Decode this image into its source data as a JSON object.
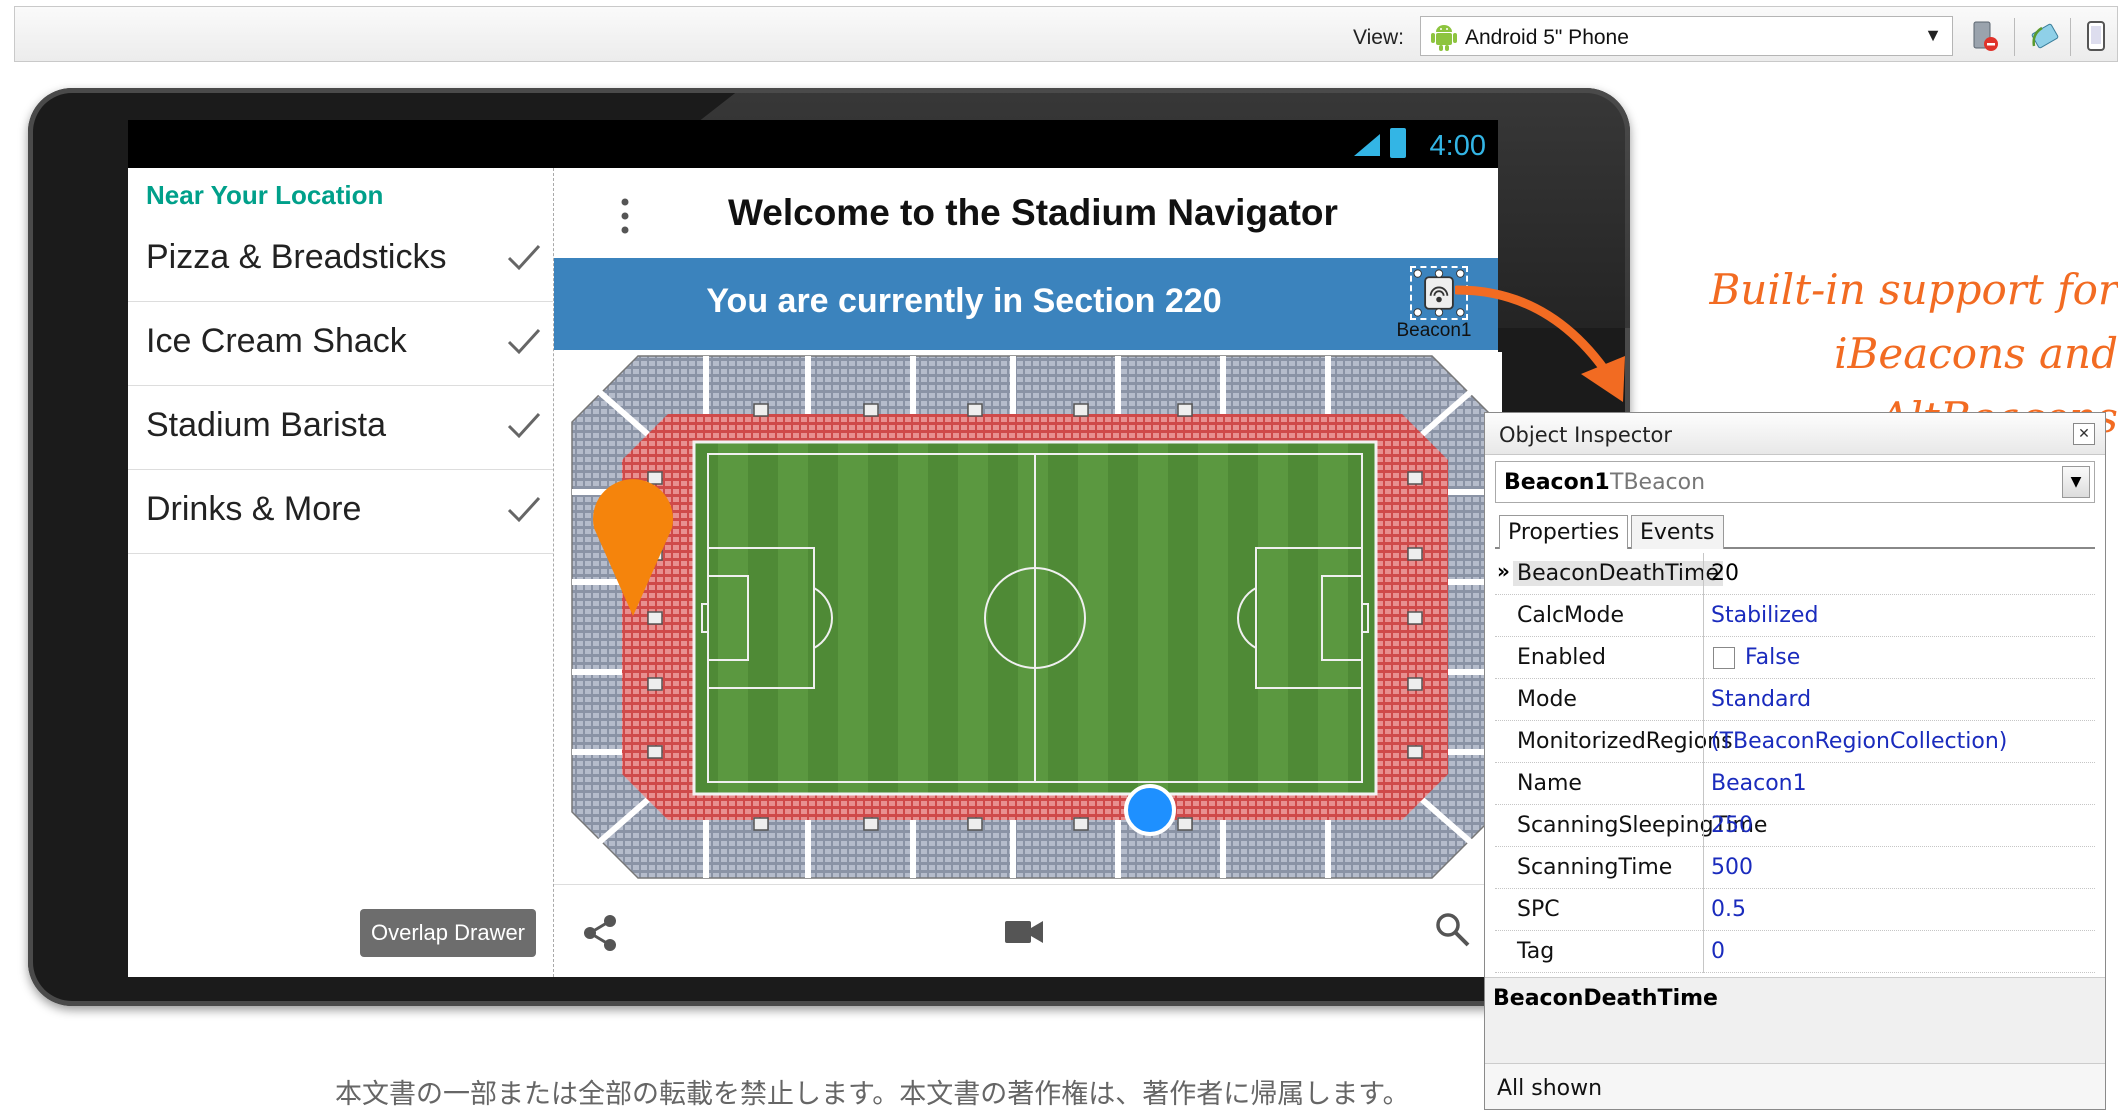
{
  "toolbar": {
    "view_label": "View:",
    "view_value": "Android 5\" Phone"
  },
  "device": {
    "status_time": "4:00"
  },
  "drawer": {
    "header": "Near Your Location",
    "items": [
      {
        "label": "Pizza & Breadsticks"
      },
      {
        "label": "Ice Cream Shack"
      },
      {
        "label": "Stadium Barista"
      },
      {
        "label": "Drinks & More"
      }
    ],
    "overlap_button": "Overlap Drawer"
  },
  "app": {
    "title": "Welcome to the Stadium Navigator",
    "section_text": "You are currently in Section 220",
    "beacon_label": "Beacon1",
    "bottom_icons": [
      "share-icon",
      "video-camera-icon",
      "search-icon"
    ]
  },
  "annotation": {
    "line1": "Built-in support for",
    "line2": "iBeacons and AltBeacons"
  },
  "object_inspector": {
    "title": "Object Inspector",
    "component_name": "Beacon1",
    "component_class": "TBeacon",
    "tabs": [
      "Properties",
      "Events"
    ],
    "properties": [
      {
        "name": "BeaconDeathTime",
        "value": "20"
      },
      {
        "name": "CalcMode",
        "value": "Stabilized"
      },
      {
        "name": "Enabled",
        "value": "False"
      },
      {
        "name": "Mode",
        "value": "Standard"
      },
      {
        "name": "MonitorizedRegions",
        "value": "(TBeaconRegionCollection)"
      },
      {
        "name": "Name",
        "value": "Beacon1"
      },
      {
        "name": "ScanningSleepingTime",
        "value": "250"
      },
      {
        "name": "ScanningTime",
        "value": "500"
      },
      {
        "name": "SPC",
        "value": "0.5"
      },
      {
        "name": "Tag",
        "value": "0"
      }
    ],
    "description": "BeaconDeathTime",
    "status": "All shown"
  },
  "footer": {
    "copyright": "本文書の一部または全部の転載を禁止します。本文書の著作権は、著作者に帰属します。"
  },
  "colors": {
    "accent": "#3b83bd",
    "drawer_header": "#00a08a",
    "annotation": "#f26b22",
    "status_bar_icon": "#33b5e5",
    "pin": "#f5840c",
    "location_dot": "#1e90ff"
  }
}
